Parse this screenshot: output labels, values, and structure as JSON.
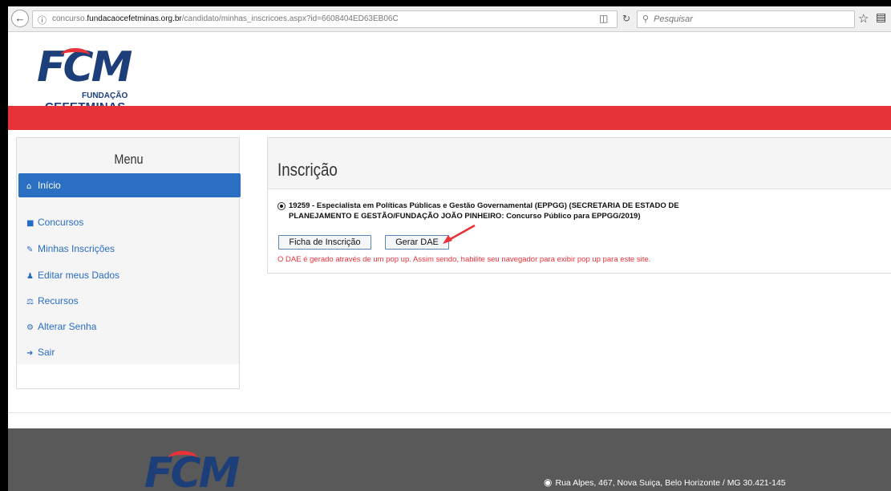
{
  "browser": {
    "url_prefix": "concurso.",
    "url_domain": "fundacaocefetminas.org.br",
    "url_path": "/candidato/minhas_inscricoes.aspx?id=6608404ED63EB06C",
    "search_placeholder": "Pesquisar"
  },
  "header": {
    "logo_main": "FCM",
    "logo_fundacao": "FUNDAÇÃO",
    "logo_cefetminas": "CEFETMINAS"
  },
  "sidebar": {
    "title": "Menu",
    "items": [
      {
        "label": "Início",
        "icon": "home-icon"
      },
      {
        "label": "Concursos",
        "icon": "folder-icon"
      },
      {
        "label": "Minhas Inscrições",
        "icon": "edit-icon"
      },
      {
        "label": "Editar meus Dados",
        "icon": "user-icon"
      },
      {
        "label": "Recursos",
        "icon": "balance-icon"
      },
      {
        "label": "Alterar Senha",
        "icon": "gear-icon"
      },
      {
        "label": "Sair",
        "icon": "sign-out-icon"
      }
    ]
  },
  "main": {
    "title": "Inscrição",
    "inscricao": "19259 - Especialista em Políticas Públicas e Gestão Governamental (EPPGG) (SECRETARIA DE ESTADO DE PLANEJAMENTO E GESTÃO/FUNDAÇÃO JOÃO PINHEIRO: Concurso Público para EPPGG/2019)",
    "btn_ficha": "Ficha de Inscrição",
    "btn_gerar": "Gerar DAE",
    "warning": "O DAE é gerado através de um pop up. Assim sendo, habilite seu navegador para exibir pop up para este site."
  },
  "footer": {
    "logo": "FCM",
    "address": "Rua Alpes, 467, Nova Suiça, Belo Horizonte / MG 30.421-145"
  },
  "colors": {
    "brand_red": "#e8323a",
    "brand_blue": "#1c3f7a",
    "active_menu": "#2b6fc2"
  }
}
